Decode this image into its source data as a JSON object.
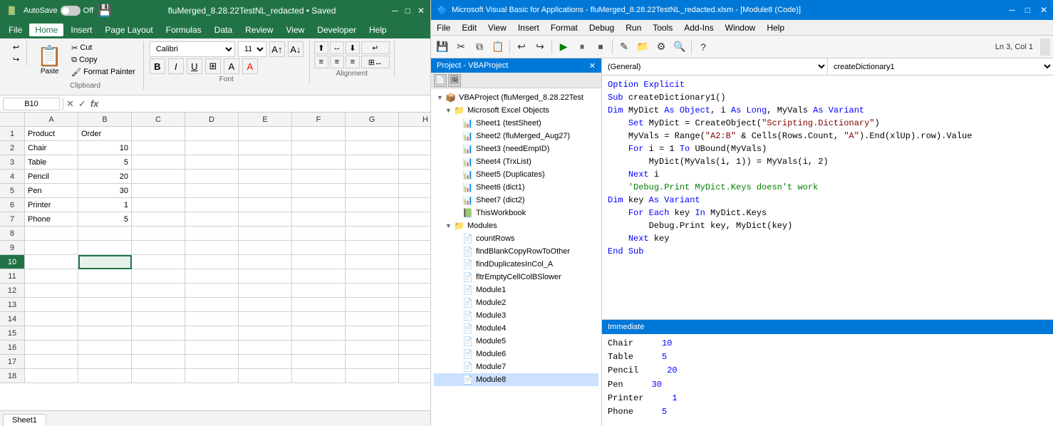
{
  "excel": {
    "title": "fluMerged_8.28.22TestNL_redacted • Saved",
    "app_icon": "📗",
    "autosave_label": "AutoSave",
    "autosave_state": "Off",
    "menus": [
      "File",
      "Home",
      "Insert",
      "Page Layout",
      "Formulas",
      "Data",
      "Review",
      "View",
      "Developer",
      "Help"
    ],
    "active_menu": "Home",
    "ribbon": {
      "undo_label": "Undo",
      "redo_label": "Redo",
      "clipboard_group": "Clipboard",
      "paste_label": "Paste",
      "cut_label": "Cut",
      "copy_label": "Copy",
      "format_painter_label": "Format Painter",
      "font_group": "Font",
      "font_name": "Calibri",
      "font_size": "11",
      "bold_label": "B",
      "italic_label": "I",
      "underline_label": "U",
      "align_group": "Alignment"
    },
    "name_box": "B10",
    "formula": "",
    "columns": [
      "A",
      "B",
      "C",
      "D",
      "E",
      "F",
      "G",
      "H"
    ],
    "rows": [
      1,
      2,
      3,
      4,
      5,
      6,
      7,
      8,
      9,
      10,
      11,
      12,
      13,
      14,
      15,
      16,
      17,
      18
    ],
    "data": {
      "headers": [
        "Product",
        "Order"
      ],
      "rows": [
        [
          "Chair",
          "10"
        ],
        [
          "Table",
          "5"
        ],
        [
          "Pencil",
          "20"
        ],
        [
          "Pen",
          "30"
        ],
        [
          "Printer",
          "1"
        ],
        [
          "Phone",
          "5"
        ]
      ]
    },
    "selected_cell": "B10",
    "sheet_tab": "Sheet1"
  },
  "vba": {
    "title": "Microsoft Visual Basic for Applications - fluMerged_8.28.22TestNL_redacted.xlsm - [Module8 (Code)]",
    "app_icon": "🔷",
    "menus": [
      "File",
      "Edit",
      "View",
      "Insert",
      "Format",
      "Debug",
      "Run",
      "Tools",
      "Add-Ins",
      "Window",
      "Help"
    ],
    "toolbar": {
      "run_label": "▶",
      "pause_label": "⏸",
      "stop_label": "⏹"
    },
    "status_bar": "Ln 3, Col 1",
    "project_panel": {
      "title": "Project - VBAProject",
      "close_btn": "×",
      "project_name": "VBAProject (fluMerged_8.28.22Test",
      "excel_objects_label": "Microsoft Excel Objects",
      "sheets": [
        "Sheet1 (testSheet)",
        "Sheet2 (fluMerged_Aug27)",
        "Sheet3 (needEmpID)",
        "Sheet4 (TrxList)",
        "Sheet5 (Duplicates)",
        "Sheet6 (dict1)",
        "Sheet7 (dict2)",
        "ThisWorkbook"
      ],
      "modules_label": "Modules",
      "modules": [
        "countRows",
        "findBlankCopyRowToOther",
        "findDuplicatesInCol_A",
        "fltrEmptyCellColBSlower",
        "Module1",
        "Module2",
        "Module3",
        "Module4",
        "Module5",
        "Module6",
        "Module7",
        "Module8"
      ]
    },
    "code_header": {
      "left_combo": "(General)",
      "right_combo": "createDictionary1"
    },
    "code": [
      {
        "text": "Option Explicit",
        "type": "option"
      },
      {
        "text": "",
        "type": "blank"
      },
      {
        "text": "Sub createDictionary1()",
        "type": "normal"
      },
      {
        "text": "Dim MyDict As Object, i As Long, MyVals As Variant",
        "type": "normal"
      },
      {
        "text": "",
        "type": "blank"
      },
      {
        "text": "    Set MyDict = CreateObject(\"Scripting.Dictionary\")",
        "type": "normal"
      },
      {
        "text": "",
        "type": "blank"
      },
      {
        "text": "    MyVals = Range(\"A2:B\" & Cells(Rows.Count, \"A\").End(xlUp).row).Value",
        "type": "normal"
      },
      {
        "text": "",
        "type": "blank"
      },
      {
        "text": "    For i = 1 To UBound(MyVals)",
        "type": "normal"
      },
      {
        "text": "        MyDict(MyVals(i, 1)) = MyVals(i, 2)",
        "type": "normal"
      },
      {
        "text": "    Next i",
        "type": "normal"
      },
      {
        "text": "    'Debug.Print MyDict.Keys doesn't work",
        "type": "comment"
      },
      {
        "text": "",
        "type": "blank"
      },
      {
        "text": "Dim key As Variant",
        "type": "normal"
      },
      {
        "text": "    For Each key In MyDict.Keys",
        "type": "normal"
      },
      {
        "text": "        Debug.Print key, MyDict(key)",
        "type": "normal"
      },
      {
        "text": "    Next key",
        "type": "normal"
      },
      {
        "text": "End Sub",
        "type": "normal"
      }
    ],
    "immediate": {
      "title": "Immediate",
      "rows": [
        {
          "key": "Chair",
          "val": "10"
        },
        {
          "key": "Table",
          "val": "5"
        },
        {
          "key": "Pencil",
          "val": "20"
        },
        {
          "key": "Pen",
          "val": "30"
        },
        {
          "key": "Printer",
          "val": "1"
        },
        {
          "key": "Phone",
          "val": "5"
        }
      ]
    }
  }
}
